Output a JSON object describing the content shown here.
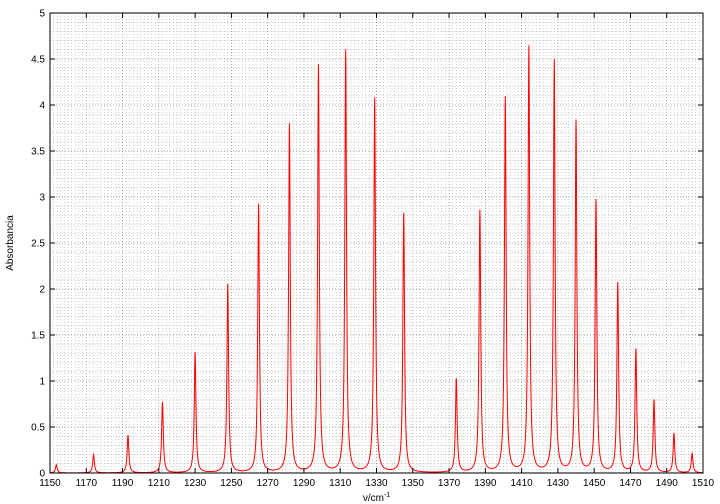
{
  "chart_data": {
    "type": "line",
    "title": "",
    "xlabel": "ν/cm",
    "xlabel_superscript": "-1",
    "ylabel": "Absorbancia",
    "xlim": [
      1150,
      1510
    ],
    "ylim": [
      0,
      5
    ],
    "x_ticks": [
      "1150",
      "1170",
      "1190",
      "1210",
      "1230",
      "1250",
      "1270",
      "1290",
      "1310",
      "1330",
      "1350",
      "1370",
      "1390",
      "1410",
      "1430",
      "1450",
      "1470",
      "1490",
      "1510"
    ],
    "y_ticks": [
      "0",
      "0.5",
      "1",
      "1.5",
      "2",
      "2.5",
      "3",
      "3.5",
      "4",
      "4.5",
      "5"
    ],
    "grid": true,
    "line_color": "#ff0000",
    "grid_color": "#a0a0a0",
    "series": [
      {
        "peaks_x": [
          1153.5,
          1174,
          1193,
          1212,
          1230,
          1248,
          1265,
          1282,
          1298,
          1313,
          1329,
          1345,
          1374,
          1387,
          1401,
          1414,
          1428,
          1440,
          1451,
          1463,
          1473,
          1483,
          1494,
          1504
        ],
        "peaks_y": [
          0.09,
          0.2,
          0.41,
          0.77,
          1.31,
          2.05,
          2.92,
          3.79,
          4.43,
          4.59,
          4.07,
          2.82,
          1.02,
          2.85,
          4.08,
          4.63,
          4.48,
          3.82,
          2.96,
          2.06,
          1.34,
          0.79,
          0.43,
          0.21
        ]
      }
    ]
  }
}
